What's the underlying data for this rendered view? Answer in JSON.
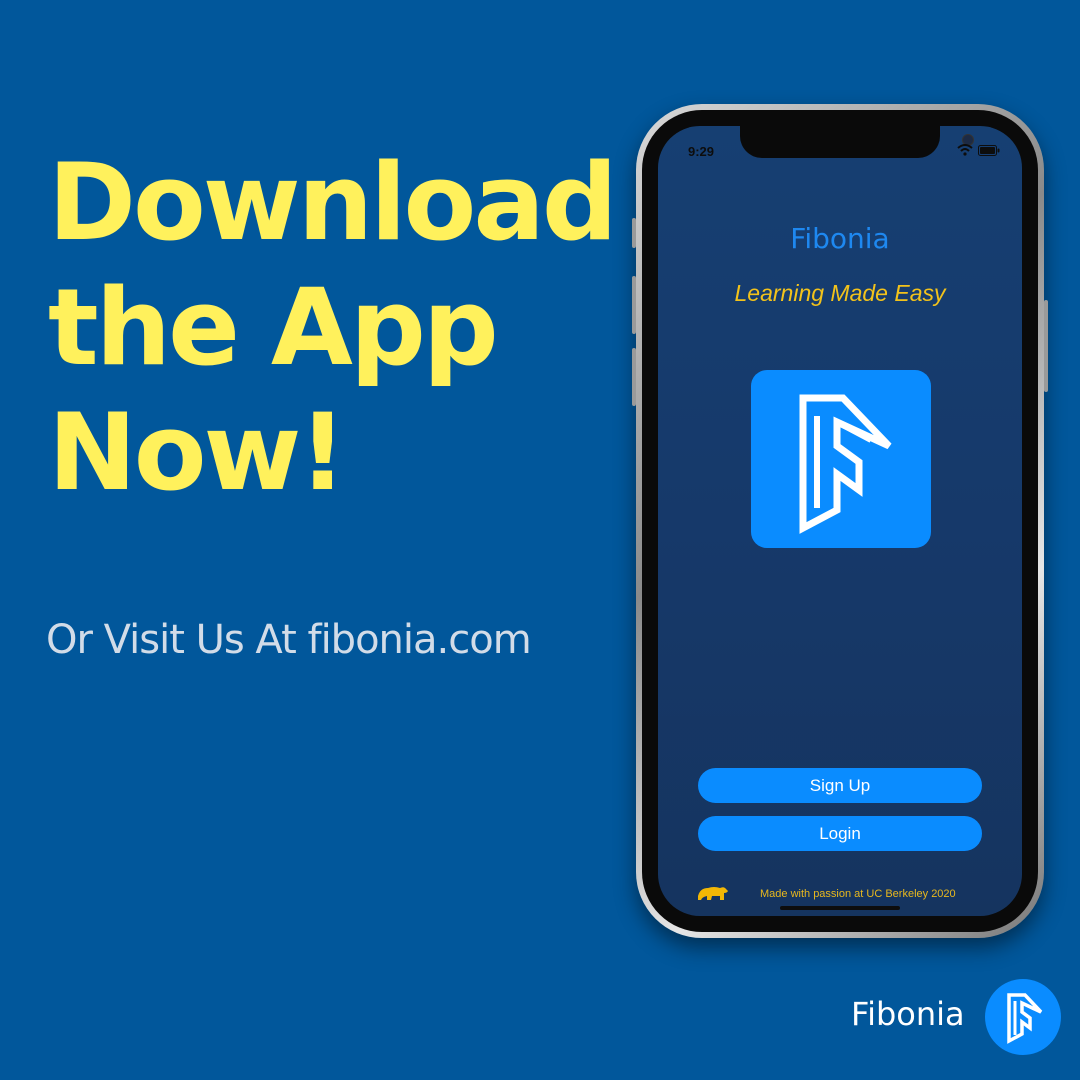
{
  "headline": {
    "lines": [
      "Download",
      "the App",
      "Now!"
    ],
    "color": "#FFF15C"
  },
  "subline": "Or Visit Us At fibonia.com",
  "phone": {
    "status": {
      "time": "9:29",
      "icons": [
        "wifi-icon",
        "battery-icon"
      ]
    },
    "app": {
      "title": "Fibonia",
      "tagline": "Learning Made Easy",
      "logo_icon": "fibonia-logo-icon",
      "signup_label": "Sign Up",
      "login_label": "Login",
      "footer_text": "Made with passion at UC Berkeley 2020",
      "footer_icon": "bear-icon"
    }
  },
  "brand": {
    "name": "Fibonia",
    "logo_icon": "fibonia-logo-icon"
  },
  "colors": {
    "background": "#01579B",
    "accent_blue": "#0A8CFF",
    "tagline_gold": "#F2C21B"
  }
}
